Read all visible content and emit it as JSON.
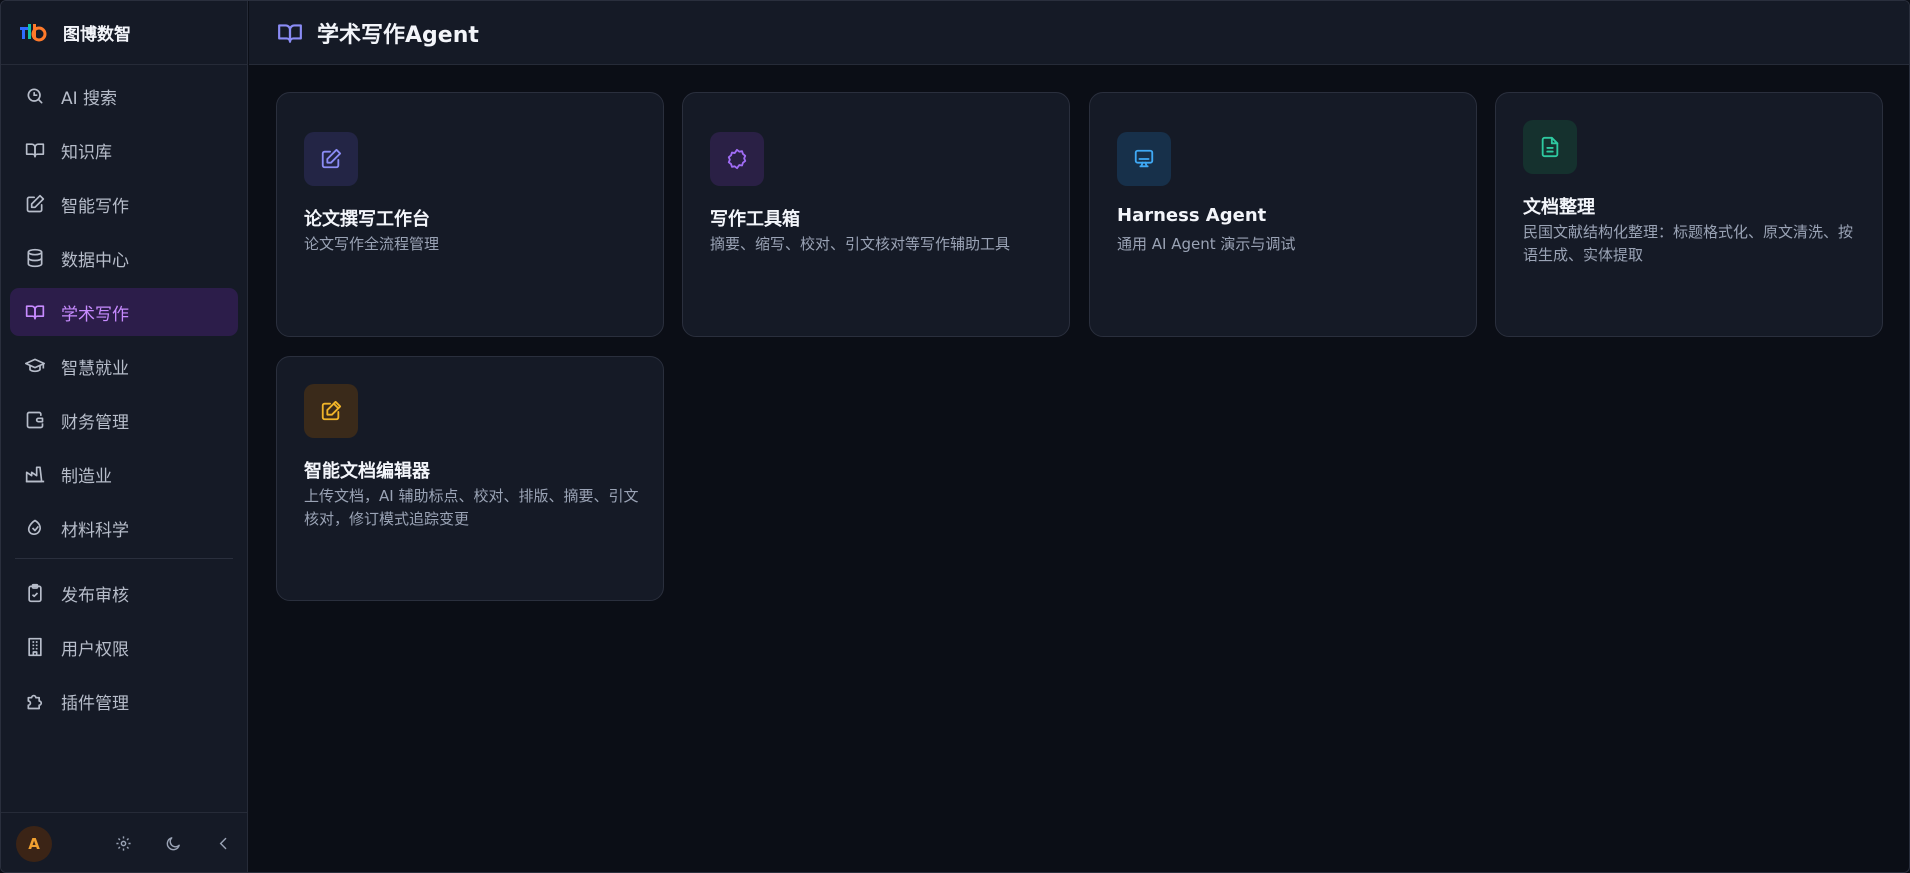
{
  "brand": {
    "name": "图博数智"
  },
  "sidebar": {
    "items": [
      {
        "label": "AI 搜索",
        "icon": "search-sparkle-icon"
      },
      {
        "label": "知识库",
        "icon": "book-open-icon"
      },
      {
        "label": "智能写作",
        "icon": "pencil-square-icon"
      },
      {
        "label": "数据中心",
        "icon": "database-icon"
      },
      {
        "label": "学术写作",
        "icon": "book-open-icon",
        "active": true
      },
      {
        "label": "智慧就业",
        "icon": "graduation-cap-icon"
      },
      {
        "label": "财务管理",
        "icon": "wallet-icon"
      },
      {
        "label": "制造业",
        "icon": "factory-icon"
      },
      {
        "label": "材料科学",
        "icon": "atom-leaf-icon"
      }
    ],
    "items_secondary": [
      {
        "label": "发布审核",
        "icon": "clipboard-check-icon"
      },
      {
        "label": "用户权限",
        "icon": "building-icon"
      },
      {
        "label": "插件管理",
        "icon": "puzzle-icon"
      }
    ]
  },
  "footer": {
    "avatar_letter": "A"
  },
  "header": {
    "title": "学术写作Agent"
  },
  "cards": [
    {
      "title": "论文撰写工作台",
      "desc": "论文写作全流程管理",
      "icon": "edit-icon",
      "icon_color": "#8b8cf5",
      "icon_bg": "#232545"
    },
    {
      "title": "写作工具箱",
      "desc": "摘要、缩写、校对、引文核对等写作辅助工具",
      "icon": "badge-icon",
      "icon_color": "#a06cf5",
      "icon_bg": "#2a2045"
    },
    {
      "title": "Harness Agent",
      "desc": "通用 AI Agent 演示与调试",
      "icon": "monitor-icon",
      "icon_color": "#3fa9f5",
      "icon_bg": "#17304a"
    },
    {
      "title": "文档整理",
      "desc": "民国文献结构化整理：标题格式化、原文清洗、按语生成、实体提取",
      "icon": "document-icon",
      "icon_color": "#2ec9a0",
      "icon_bg": "#15312e"
    },
    {
      "title": "智能文档编辑器",
      "desc": "上传文档，AI 辅助标点、校对、排版、摘要、引文核对，修订模式追踪变更",
      "icon": "external-edit-icon",
      "icon_color": "#f0b429",
      "icon_bg": "#3a2a1a"
    }
  ],
  "colors": {
    "accent": "#c78bff",
    "active_bg": "#2c1d4a",
    "panel": "#151a26",
    "background": "#0b0e16"
  }
}
